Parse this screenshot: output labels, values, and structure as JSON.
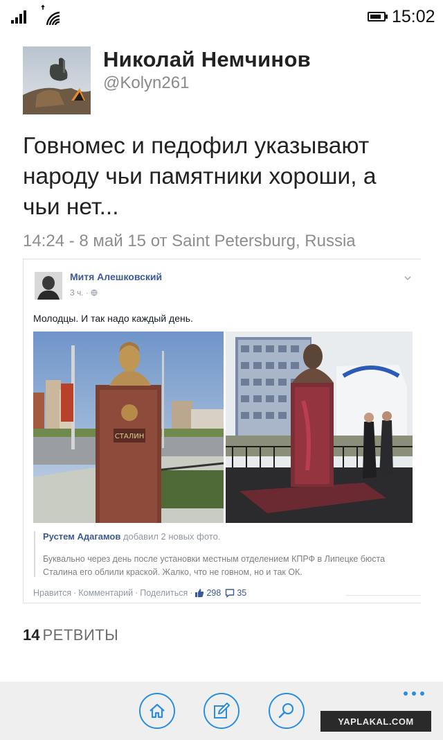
{
  "status_bar": {
    "time": "15:02",
    "signal_icon": "signal-bars-icon",
    "wifi_icon": "wifi-icon",
    "battery_icon": "battery-icon",
    "battery_level": 0.85
  },
  "tweet": {
    "user_name": "Николай Немчинов",
    "user_handle": "@Kolyn261",
    "text": "Говномес и педофил  указывают народу чьи памятники хороши, а чьи нет...",
    "meta": "14:24 - 8 май 15 от Saint Petersburg, Russia",
    "retweet_count": "14",
    "retweet_label": "РЕТВИТЫ"
  },
  "embedded_post": {
    "author": "Митя Алешковский",
    "time": "3 ч. · ",
    "globe_icon": "globe-icon",
    "text": "Молодцы. И так надо каждый день.",
    "photo_plaque_text": "СТАЛИН",
    "shared_author": "Рустем Адагамов",
    "shared_action": " добавил 2 новых фото.",
    "shared_text": "Буквально через день после установки местным отделением КПРФ в Липецке бюста Сталина его облили краской. Жалко, что не говном, но и так ОК.",
    "actions": {
      "like": "Нравится",
      "comment": "Комментарий",
      "share": "Поделиться",
      "likes_count": "298",
      "comments_count": "35"
    }
  },
  "app_bar": {
    "buttons": [
      {
        "name": "home",
        "icon": "home-icon"
      },
      {
        "name": "compose",
        "icon": "compose-icon"
      },
      {
        "name": "search",
        "icon": "search-icon"
      }
    ],
    "more_icon": "more-dots-icon",
    "accent_color": "#2a8de4"
  },
  "watermark": "YAPLAKAL.COM"
}
